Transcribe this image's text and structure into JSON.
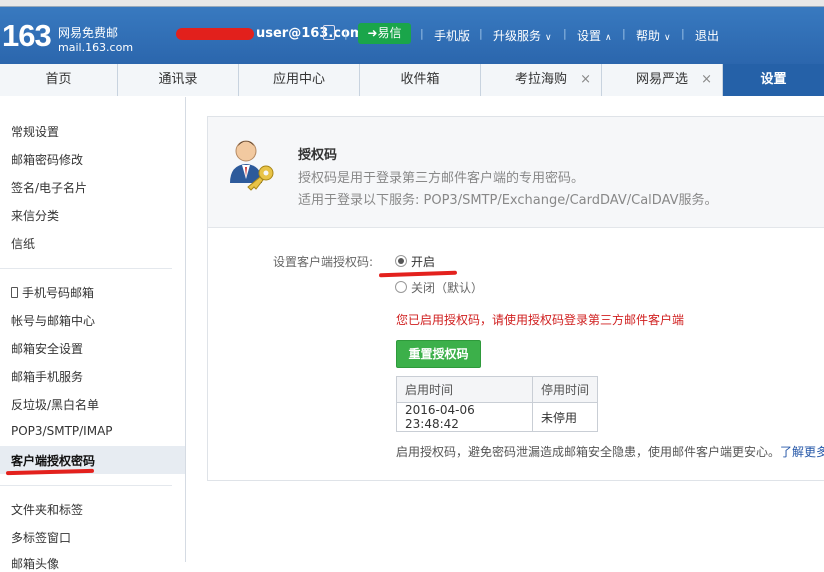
{
  "header": {
    "logo_number": "163",
    "logo_title": "网易免费邮",
    "logo_domain": "mail.163.com",
    "account": "user@163.com",
    "yixin_label": "易信",
    "links": [
      "手机版",
      "升级服务",
      "设置",
      "帮助",
      "退出"
    ],
    "carets": [
      "∨",
      "∧",
      "∨"
    ]
  },
  "tabs": {
    "home": "首页",
    "contacts": "通讯录",
    "apps": "应用中心",
    "inbox": "收件箱",
    "kaola": "考拉海购",
    "yanxuan": "网易严选",
    "settings": "设置",
    "close": "×"
  },
  "sidebar": {
    "group1": [
      "常规设置",
      "邮箱密码修改",
      "签名/电子名片",
      "来信分类",
      "信纸"
    ],
    "group2": [
      "手机号码邮箱",
      "帐号与邮箱中心",
      "邮箱安全设置",
      "邮箱手机服务",
      "反垃圾/黑白名单",
      "POP3/SMTP/IMAP",
      "客户端授权密码"
    ],
    "group3": [
      "文件夹和标签",
      "多标签窗口",
      "邮箱头像"
    ]
  },
  "auth": {
    "title": "授权码",
    "desc1": "授权码是用于登录第三方邮件客户端的专用密码。",
    "desc2": "适用于登录以下服务: POP3/SMTP/Exchange/CardDAV/CalDAV服务。",
    "setting_label": "设置客户端授权码:",
    "option_on": "开启",
    "option_off": "关闭（默认）",
    "selected": "开启",
    "notice": "您已启用授权码，请使用授权码登录第三方邮件客户端",
    "reset_button": "重置授权码",
    "table_headers": [
      "启用时间",
      "停用时间"
    ],
    "table_values": [
      "2016-04-06 23:48:42",
      "未停用"
    ],
    "footer": "启用授权码，避免密码泄漏造成邮箱安全隐患，使用邮件客户端更安心。",
    "footer_link": "了解更多"
  },
  "colors": {
    "header_blue": "#2f6fb7",
    "tab_active": "#2561a8",
    "button_green": "#3cb04a",
    "notice_red": "#d02020",
    "annotation_red": "#e3211d"
  }
}
